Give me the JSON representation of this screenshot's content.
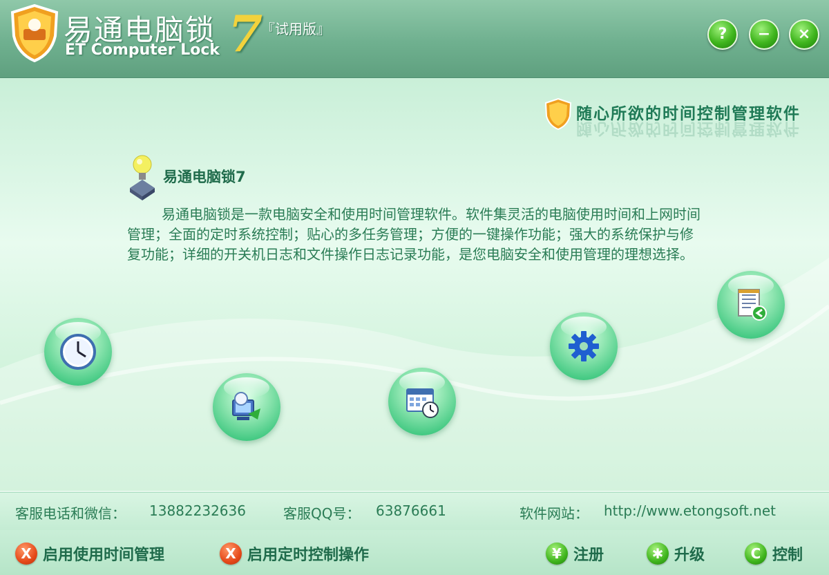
{
  "title_bar": {
    "app_name_cn": "易通电脑锁",
    "app_name_en": "ET Computer Lock",
    "version_number": "7",
    "edition": "『试用版』",
    "help_button": "?",
    "minimize_button": "−",
    "close_button": "×"
  },
  "slogan": "随心所欲的时间控制管理软件",
  "info": {
    "title": "易通电脑锁7",
    "description": "易通电脑锁是一款电脑安全和使用时间管理软件。软件集灵活的电脑使用时间和上网时间管理；全面的定时系统控制；贴心的多任务管理；方便的一键操作功能；强大的系统保护与修复功能；详细的开关机日志和文件操作日志记录功能，是您电脑安全和使用管理的理想选择。"
  },
  "feature_orbs": [
    {
      "name": "clock-icon"
    },
    {
      "name": "network-monitor-icon"
    },
    {
      "name": "calendar-schedule-icon"
    },
    {
      "name": "gear-settings-icon"
    },
    {
      "name": "log-document-icon"
    }
  ],
  "contact": {
    "phone_label": "客服电话和微信：",
    "phone_value": "13882232636",
    "qq_label": "客服QQ号：",
    "qq_value": "63876661",
    "website_label": "软件网站：",
    "website_value": "http://www.etongsoft.net"
  },
  "actions": {
    "time_mgmt": {
      "icon": "X",
      "label": "启用使用时间管理"
    },
    "timer_ctrl": {
      "icon": "X",
      "label": "启用定时控制操作"
    },
    "register": {
      "icon": "¥",
      "label": "注册"
    },
    "upgrade": {
      "icon": "✱",
      "label": "升级"
    },
    "control": {
      "icon": "C",
      "label": "控制"
    }
  },
  "colors": {
    "accent": "#1f6b4b",
    "title_bar": "#6fb08f",
    "orb_green": "#35c47a",
    "disabled_red": "#e64a1a",
    "button_green": "#3fb51d"
  }
}
